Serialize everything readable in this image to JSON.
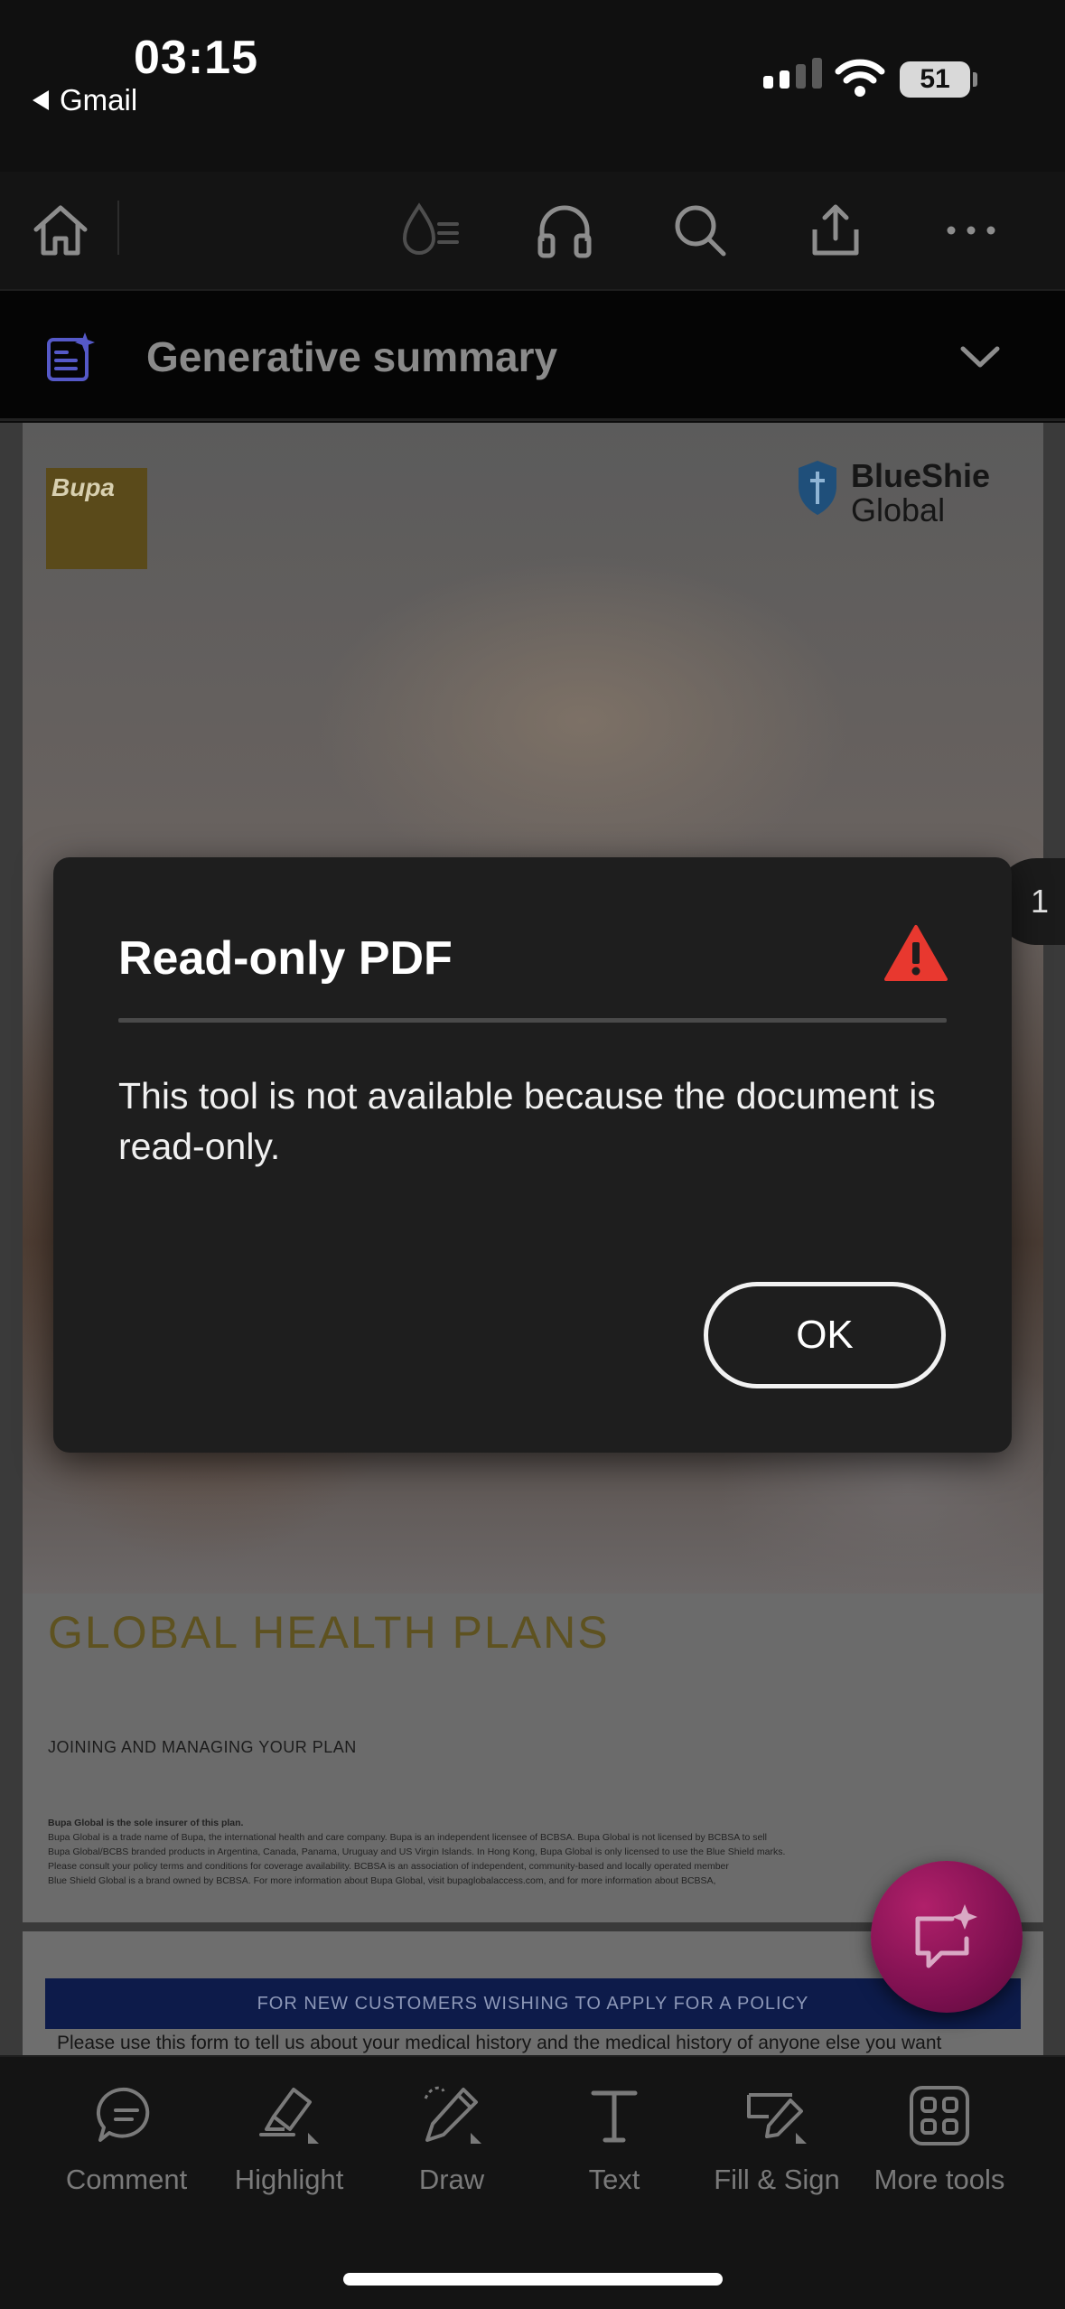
{
  "status_bar": {
    "time": "03:15",
    "back_app": "Gmail",
    "battery": "51",
    "signal_bars": 2
  },
  "toolbar": {
    "icons": [
      "home-icon",
      "read-aloud-icon",
      "headphones-icon",
      "search-icon",
      "share-icon",
      "more-icon"
    ]
  },
  "generative_summary": {
    "label": "Generative summary"
  },
  "document": {
    "page_number": "1",
    "brand_left": "Bupa",
    "brand_right_line1": "BlueShie",
    "brand_right_line2": "Global",
    "title": "GLOBAL HEALTH PLANS",
    "subtitle": "JOINING AND MANAGING YOUR PLAN",
    "fine_print_bold": "Bupa Global is the sole insurer of this plan.",
    "fine_print": [
      "Bupa Global is a trade name of Bupa, the international health and care company. Bupa is an independent licensee of BCBSA. Bupa Global is not licensed by BCBSA to sell",
      "Bupa Global/BCBS branded products in Argentina, Canada, Panama, Uruguay and US Virgin Islands. In Hong Kong, Bupa Global is only licensed to use the Blue Shield marks.",
      "Please consult your policy terms and conditions for coverage availability. BCBSA is an association of independent, community-based and locally operated member",
      "Blue Shield Global is a brand owned by BCBSA. For more information about Bupa Global, visit bupaglobalaccess.com, and for more information about BCBSA,"
    ],
    "page2_header": "FOR NEW CUSTOMERS WISHING TO APPLY FOR A POLICY",
    "page2_text": "Please use this form to tell us about your medical history and the medical history of anyone else you want"
  },
  "dialog": {
    "title": "Read-only PDF",
    "message": "This tool is not available because the document is read-only.",
    "ok_label": "OK"
  },
  "bottom_tools": [
    {
      "label": "Comment",
      "icon": "comment-icon"
    },
    {
      "label": "Highlight",
      "icon": "highlight-icon"
    },
    {
      "label": "Draw",
      "icon": "draw-icon"
    },
    {
      "label": "Text",
      "icon": "text-icon"
    },
    {
      "label": "Fill & Sign",
      "icon": "fill-sign-icon"
    },
    {
      "label": "More tools",
      "icon": "more-tools-icon"
    }
  ],
  "colors": {
    "warning": "#e8382f",
    "accent_purple": "#5b5fd9",
    "fab": "#9a1560"
  }
}
